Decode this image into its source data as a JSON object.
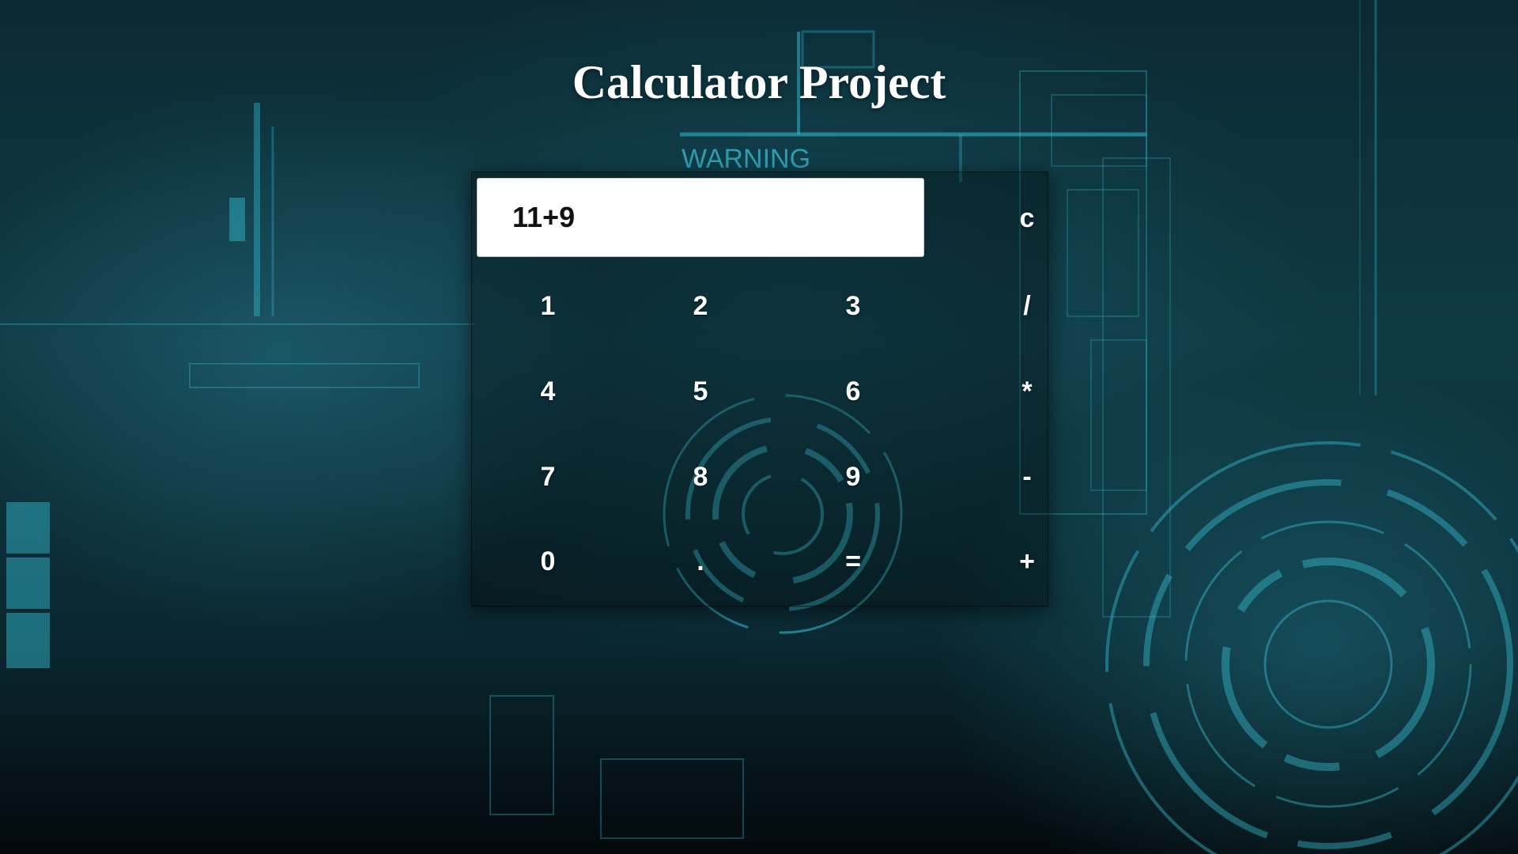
{
  "page": {
    "title": "Calculator Project"
  },
  "background": {
    "warning_text": "WARNING"
  },
  "calculator": {
    "display_value": "11+9",
    "keys": {
      "clear": "c",
      "one": "1",
      "two": "2",
      "three": "3",
      "divide": "/",
      "four": "4",
      "five": "5",
      "six": "6",
      "multiply": "*",
      "seven": "7",
      "eight": "8",
      "nine": "9",
      "subtract": "-",
      "zero": "0",
      "decimal": ".",
      "equals": "=",
      "add": "+"
    }
  },
  "colors": {
    "title": "#ffffff",
    "display_background": "#ffffff",
    "display_text": "#111111",
    "key_text": "#ffffff",
    "accent_cyan": "#2fb4c8"
  }
}
